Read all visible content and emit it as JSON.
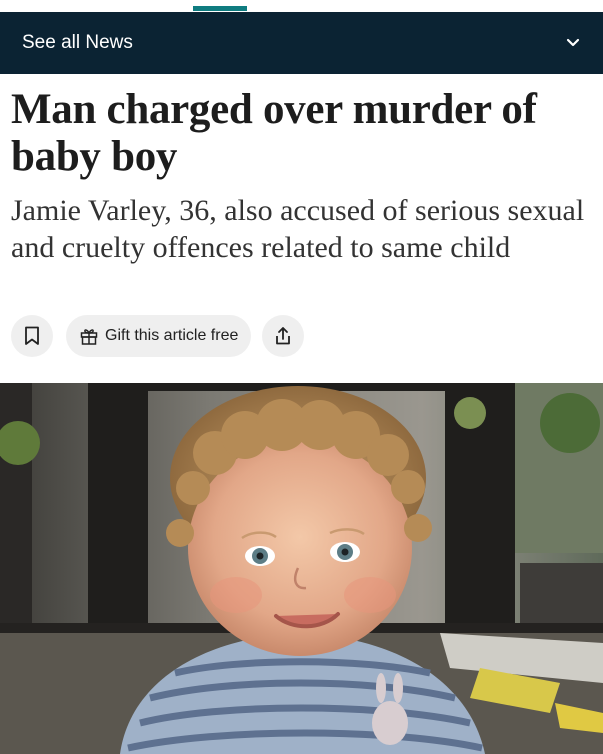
{
  "news_bar": {
    "label": "See all News",
    "chevron_icon": "chevron-down-icon"
  },
  "article": {
    "headline_line1": "Man charged over murder of",
    "headline_line2": "baby boy",
    "standfirst": "Jamie Varley, 36, also accused of serious sexual and cruelty offences related to same child"
  },
  "actions": {
    "bookmark_icon": "bookmark-icon",
    "gift_label": "Gift this article free",
    "gift_icon": "gift-icon",
    "share_icon": "share-icon"
  },
  "colors": {
    "nav_bg": "#0b2333",
    "accent": "#0f7c80",
    "button_bg": "#efefef"
  }
}
